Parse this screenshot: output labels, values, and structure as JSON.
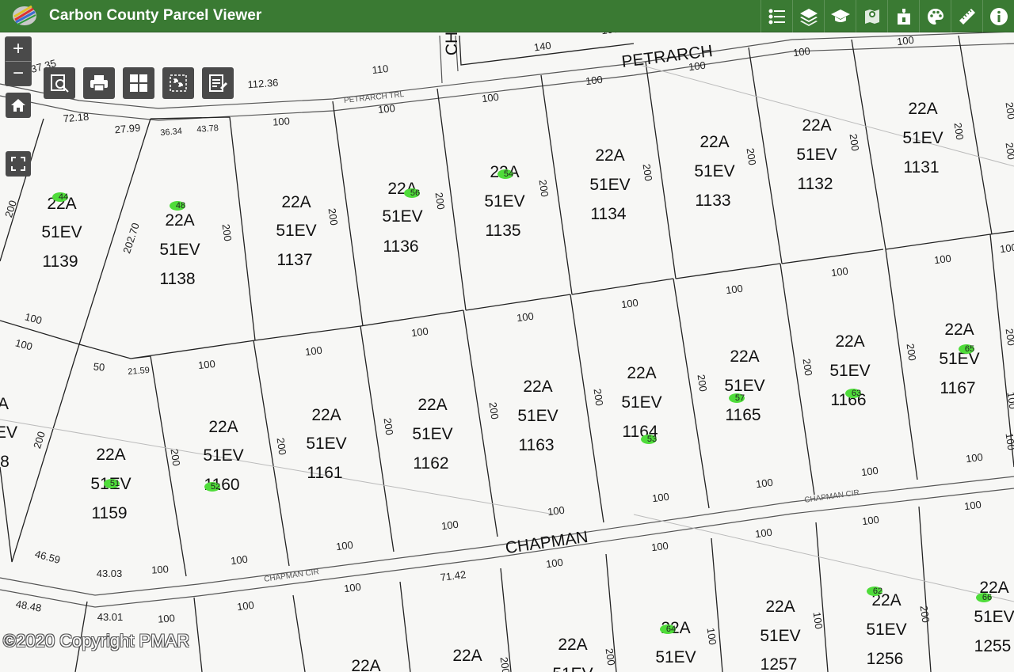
{
  "app": {
    "title": "Carbon County Parcel Viewer"
  },
  "toolbar": [
    {
      "name": "legend-icon"
    },
    {
      "name": "layers-icon"
    },
    {
      "name": "education-icon"
    },
    {
      "name": "map-marker-icon"
    },
    {
      "name": "bookmark-add-icon"
    },
    {
      "name": "palette-icon"
    },
    {
      "name": "ruler-icon"
    },
    {
      "name": "info-icon"
    }
  ],
  "controls": {
    "zoom_in": "+",
    "zoom_out": "−"
  },
  "copyright": "©2020 Copyright PMAR",
  "streets": [
    {
      "label": "PETRARCH"
    },
    {
      "label": "PETRARCH TRL"
    },
    {
      "label": "CHAPMAN"
    },
    {
      "label": "CHAPMAN CIR"
    },
    {
      "label": "CHAPMAN CIR"
    },
    {
      "label": "CH"
    }
  ],
  "parcels": [
    {
      "l1": "22A",
      "l2": "51EV",
      "l3": "1139"
    },
    {
      "l1": "22A",
      "l2": "51EV",
      "l3": "1138"
    },
    {
      "l1": "22A",
      "l2": "51EV",
      "l3": "1137"
    },
    {
      "l1": "22A",
      "l2": "51EV",
      "l3": "1136"
    },
    {
      "l1": "22A",
      "l2": "51EV",
      "l3": "1135"
    },
    {
      "l1": "22A",
      "l2": "51EV",
      "l3": "1134"
    },
    {
      "l1": "22A",
      "l2": "51EV",
      "l3": "1133"
    },
    {
      "l1": "22A",
      "l2": "51EV",
      "l3": "1132"
    },
    {
      "l1": "22A",
      "l2": "51EV",
      "l3": "1131"
    },
    {
      "l1": "22A",
      "l2": "51EV",
      "l3": "1159"
    },
    {
      "l1": "22A",
      "l2": "51EV",
      "l3": "1160"
    },
    {
      "l1": "22A",
      "l2": "51EV",
      "l3": "1161"
    },
    {
      "l1": "22A",
      "l2": "51EV",
      "l3": "1162"
    },
    {
      "l1": "22A",
      "l2": "51EV",
      "l3": "1163"
    },
    {
      "l1": "22A",
      "l2": "51EV",
      "l3": "1164"
    },
    {
      "l1": "22A",
      "l2": "51EV",
      "l3": "1165"
    },
    {
      "l1": "22A",
      "l2": "51EV",
      "l3": "1166"
    },
    {
      "l1": "22A",
      "l2": "51EV",
      "l3": "1167"
    },
    {
      "l1": "22A",
      "l2": "51EV",
      "l3": "1257"
    },
    {
      "l1": "22A",
      "l2": "51EV",
      "l3": "1256"
    },
    {
      "l1": "22A",
      "l2": "51EV",
      "l3": "1255"
    },
    {
      "l1": "22A",
      "l2": "51EV",
      "l3": ""
    },
    {
      "l1": "22A",
      "l2": "51EV",
      "l3": ""
    },
    {
      "l1": "22A",
      "l2": "",
      "l3": ""
    },
    {
      "l1": "22A",
      "l2": "",
      "l3": ""
    },
    {
      "l1": "A",
      "l2": "EV",
      "l3": "8"
    }
  ],
  "dimensions": [
    "140",
    "110",
    "112.36",
    "100",
    "100",
    "100",
    "100",
    "100",
    "100",
    "100",
    "100",
    "37.35",
    "72.18",
    "27.99",
    "36.34",
    "43.78",
    "200",
    "200",
    "200",
    "200",
    "200",
    "200",
    "200",
    "200",
    "202.70",
    "200",
    "100",
    "100",
    "50",
    "21.59",
    "100",
    "100",
    "100",
    "100",
    "100",
    "100",
    "100",
    "100",
    "100",
    "200",
    "200",
    "200",
    "200",
    "200",
    "200",
    "200",
    "200",
    "200",
    "200",
    "100",
    "100",
    "100",
    "100",
    "100",
    "100",
    "100",
    "100",
    "100",
    "100",
    "71.42",
    "46.59",
    "43.03",
    "100",
    "48.48",
    "43.01",
    "100",
    "100",
    "100",
    "100",
    "100",
    "100",
    "100",
    "100",
    "100",
    "200",
    "200",
    "200",
    "200",
    "200",
    "100",
    "100",
    "100"
  ],
  "house_numbers": [
    "44",
    "48",
    "56",
    "54",
    "57",
    "63",
    "65",
    "53",
    "51",
    "52",
    "62",
    "64",
    "66"
  ],
  "colors": {
    "header": "#3a7a33",
    "house_marker": "#4fdc3a"
  }
}
